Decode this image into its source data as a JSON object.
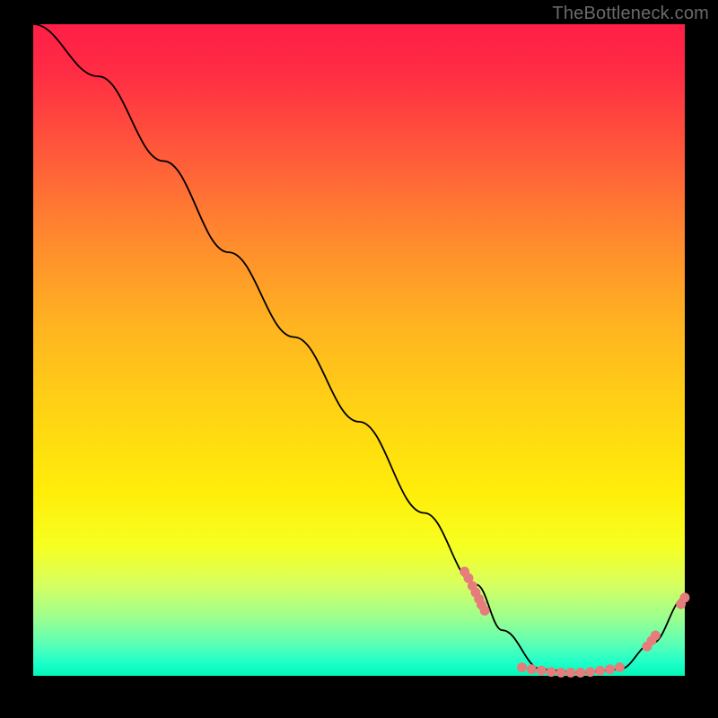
{
  "watermark": "TheBottleneck.com",
  "chart_data": {
    "type": "line",
    "title": "",
    "xlabel": "",
    "ylabel": "",
    "xlim": [
      0,
      100
    ],
    "ylim": [
      0,
      100
    ],
    "series": [
      {
        "name": "curve",
        "x": [
          0,
          10,
          20,
          30,
          40,
          50,
          60,
          68,
          72,
          78,
          84,
          90,
          95,
          100
        ],
        "y": [
          100,
          92,
          79,
          65,
          52,
          39,
          25,
          14,
          7,
          1,
          0.5,
          1,
          5,
          12
        ]
      }
    ],
    "markers": [
      {
        "name": "cluster-a",
        "x": 66.2,
        "y": 16.0
      },
      {
        "name": "cluster-a",
        "x": 66.8,
        "y": 15.0
      },
      {
        "name": "cluster-a",
        "x": 67.4,
        "y": 13.8
      },
      {
        "name": "cluster-a",
        "x": 67.9,
        "y": 12.8
      },
      {
        "name": "cluster-a",
        "x": 68.4,
        "y": 11.8
      },
      {
        "name": "cluster-a",
        "x": 68.8,
        "y": 10.9
      },
      {
        "name": "cluster-a",
        "x": 69.3,
        "y": 10.0
      },
      {
        "name": "bottom",
        "x": 75.0,
        "y": 1.3
      },
      {
        "name": "bottom",
        "x": 76.5,
        "y": 1.0
      },
      {
        "name": "bottom",
        "x": 78.0,
        "y": 0.8
      },
      {
        "name": "bottom",
        "x": 79.5,
        "y": 0.6
      },
      {
        "name": "bottom",
        "x": 81.0,
        "y": 0.5
      },
      {
        "name": "bottom",
        "x": 82.5,
        "y": 0.5
      },
      {
        "name": "bottom",
        "x": 84.0,
        "y": 0.5
      },
      {
        "name": "bottom",
        "x": 85.5,
        "y": 0.6
      },
      {
        "name": "bottom",
        "x": 87.0,
        "y": 0.8
      },
      {
        "name": "bottom",
        "x": 88.5,
        "y": 1.0
      },
      {
        "name": "bottom",
        "x": 90.0,
        "y": 1.3
      },
      {
        "name": "cluster-b",
        "x": 94.2,
        "y": 4.5
      },
      {
        "name": "cluster-b",
        "x": 94.9,
        "y": 5.4
      },
      {
        "name": "cluster-b",
        "x": 95.5,
        "y": 6.2
      },
      {
        "name": "end",
        "x": 99.4,
        "y": 11.0
      },
      {
        "name": "end",
        "x": 100.0,
        "y": 12.0
      }
    ],
    "gradient_stops": [
      {
        "pos": 0,
        "color": "#ff1f47"
      },
      {
        "pos": 7,
        "color": "#ff2b44"
      },
      {
        "pos": 20,
        "color": "#ff5a3a"
      },
      {
        "pos": 33,
        "color": "#ff8a2e"
      },
      {
        "pos": 46,
        "color": "#ffb321"
      },
      {
        "pos": 59,
        "color": "#ffd214"
      },
      {
        "pos": 72,
        "color": "#ffee0a"
      },
      {
        "pos": 80,
        "color": "#f7ff20"
      },
      {
        "pos": 86,
        "color": "#d7ff60"
      },
      {
        "pos": 91,
        "color": "#9dff8e"
      },
      {
        "pos": 95,
        "color": "#5dffb4"
      },
      {
        "pos": 98,
        "color": "#1effc9"
      },
      {
        "pos": 100,
        "color": "#02f7b8"
      }
    ],
    "marker_color": "#e67c7c",
    "line_color": "#000000"
  }
}
